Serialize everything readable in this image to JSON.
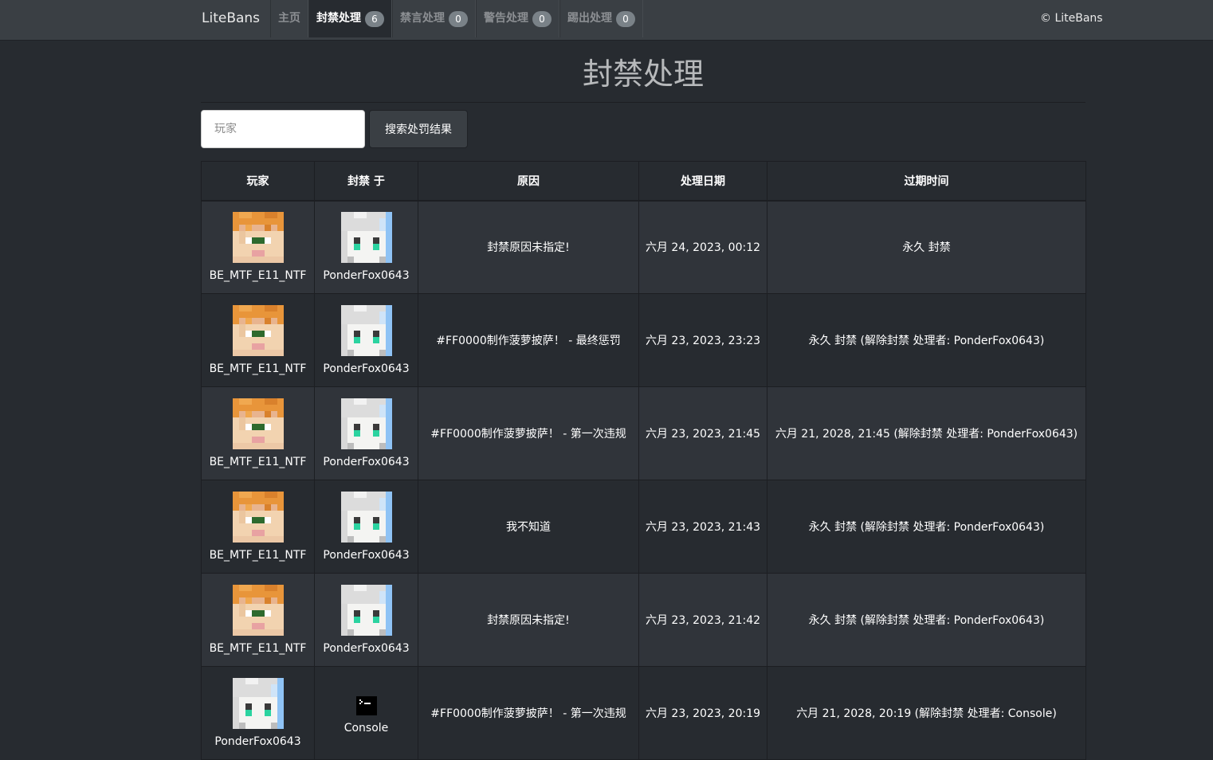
{
  "navbar": {
    "brand": "LiteBans",
    "items": [
      {
        "label": "主页",
        "badge": null
      },
      {
        "label": "封禁处理",
        "badge": "6"
      },
      {
        "label": "禁言处理",
        "badge": "0"
      },
      {
        "label": "警告处理",
        "badge": "0"
      },
      {
        "label": "踢出处理",
        "badge": "0"
      }
    ],
    "active_index": 1,
    "copyright": "© LiteBans"
  },
  "page": {
    "title": "封禁处理"
  },
  "search": {
    "placeholder": "玩家",
    "value": "",
    "button_label": "搜索处罚结果"
  },
  "table": {
    "headers": [
      "玩家",
      "封禁 于",
      "原因",
      "处理日期",
      "过期时间"
    ],
    "rows": [
      {
        "player": "BE_MTF_E11_NTF",
        "player_avatar": "orange-hair-skin-icon",
        "banned_by": "PonderFox0643",
        "banned_by_avatar": "white-hair-skin-icon",
        "reason": "封禁原因未指定!",
        "date": "六月 24, 2023, 00:12",
        "expires": "永久 封禁"
      },
      {
        "player": "BE_MTF_E11_NTF",
        "player_avatar": "orange-hair-skin-icon",
        "banned_by": "PonderFox0643",
        "banned_by_avatar": "white-hair-skin-icon",
        "reason": "#FF0000制作菠萝披萨！ - 最终惩罚",
        "date": "六月 23, 2023, 23:23",
        "expires": "永久 封禁 (解除封禁 处理者: PonderFox0643)"
      },
      {
        "player": "BE_MTF_E11_NTF",
        "player_avatar": "orange-hair-skin-icon",
        "banned_by": "PonderFox0643",
        "banned_by_avatar": "white-hair-skin-icon",
        "reason": "#FF0000制作菠萝披萨！ - 第一次违规",
        "date": "六月 23, 2023, 21:45",
        "expires": "六月 21, 2028, 21:45 (解除封禁 处理者: PonderFox0643)"
      },
      {
        "player": "BE_MTF_E11_NTF",
        "player_avatar": "orange-hair-skin-icon",
        "banned_by": "PonderFox0643",
        "banned_by_avatar": "white-hair-skin-icon",
        "reason": "我不知道",
        "date": "六月 23, 2023, 21:43",
        "expires": "永久 封禁 (解除封禁 处理者: PonderFox0643)"
      },
      {
        "player": "BE_MTF_E11_NTF",
        "player_avatar": "orange-hair-skin-icon",
        "banned_by": "PonderFox0643",
        "banned_by_avatar": "white-hair-skin-icon",
        "reason": "封禁原因未指定!",
        "date": "六月 23, 2023, 21:42",
        "expires": "永久 封禁 (解除封禁 处理者: PonderFox0643)"
      },
      {
        "player": "PonderFox0643",
        "player_avatar": "white-hair-skin-icon",
        "banned_by": "Console",
        "banned_by_avatar": "console-icon",
        "reason": "#FF0000制作菠萝披萨！ - 第一次违规",
        "date": "六月 23, 2023, 20:19",
        "expires": "六月 21, 2028, 20:19 (解除封禁 处理者: Console)"
      }
    ]
  },
  "colors": {
    "background": "#272b30",
    "navbar": "#3a3f44",
    "row_odd": "#30343a",
    "badge": "#7a8288"
  }
}
